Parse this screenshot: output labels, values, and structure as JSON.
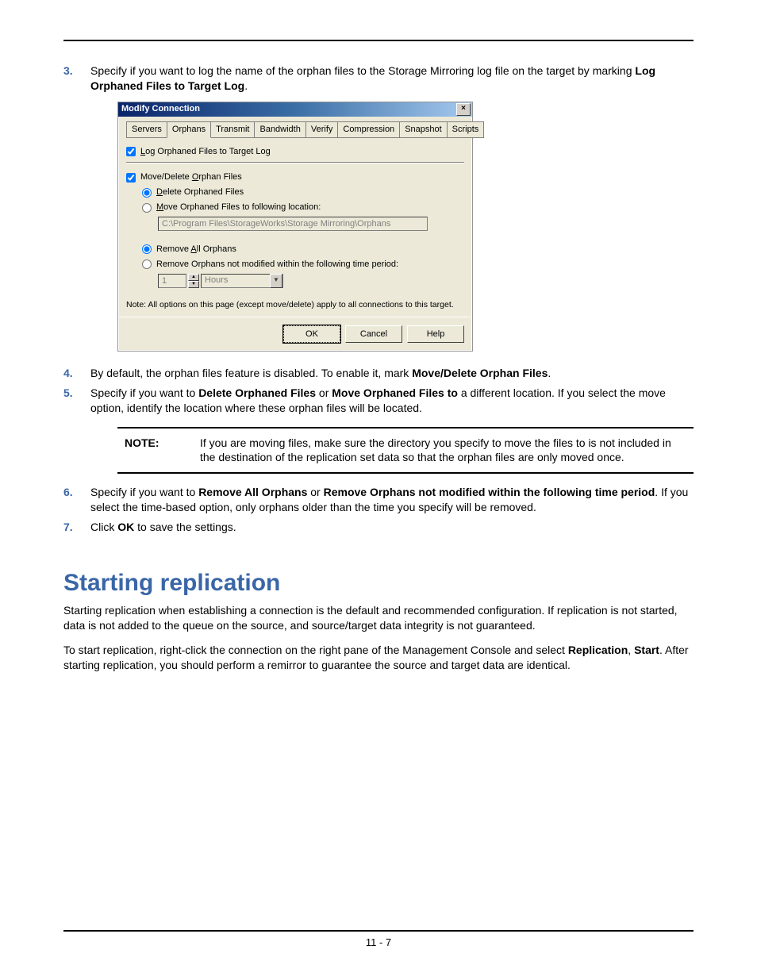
{
  "step3": {
    "num": "3.",
    "pre": "Specify if you want to log the name of the orphan files to the Storage Mirroring log file on the target by marking ",
    "bold": "Log Orphaned Files to Target Log",
    "post": "."
  },
  "dialog": {
    "title": "Modify Connection",
    "tabs": [
      "Servers",
      "Orphans",
      "Transmit",
      "Bandwidth",
      "Verify",
      "Compression",
      "Snapshot",
      "Scripts"
    ],
    "logLabel": "og Orphaned Files to Target Log",
    "logMn": "L",
    "moveDeleteLabel": "rphan Files",
    "moveDeletePre": "Move/Delete ",
    "moveDeleteMn": "O",
    "deleteLabel": "elete Orphaned Files",
    "deleteMn": "D",
    "moveToLabel": "ove Orphaned Files to following location:",
    "moveToMn": "M",
    "path": "C:\\Program Files\\StorageWorks\\Storage Mirroring\\Orphans",
    "removeAllPre": "Remove ",
    "removeAllMn": "A",
    "removeAllPost": "ll Orphans",
    "removeTime": "Remove Orphans not modified within the following time period:",
    "numVal": "1",
    "unit": "Hours",
    "note": "Note: All options on this page (except move/delete) apply to all connections to this target.",
    "ok": "OK",
    "cancel": "Cancel",
    "help": "Help"
  },
  "step4": {
    "num": "4.",
    "pre": "By default, the orphan files feature is disabled. To enable it, mark ",
    "bold": "Move/Delete Orphan Files",
    "post": "."
  },
  "step5": {
    "num": "5.",
    "pre": "Specify if you want to ",
    "b1": "Delete Orphaned Files",
    "mid1": " or ",
    "b2": "Move Orphaned Files to",
    "post": " a different location. If you select the move option, identify the location where these orphan files will be located."
  },
  "notebox": {
    "label": "NOTE:",
    "text": "If you are moving files, make sure the directory you specify to move the files to is not included in the destination of the replication set data so that the orphan files are only moved once."
  },
  "step6": {
    "num": "6.",
    "pre": "Specify if you want to ",
    "b1": "Remove All Orphans",
    "mid1": " or ",
    "b2": "Remove Orphans not modified within the following time period",
    "post": ". If you select the time-based option, only orphans older than the time you specify will be removed."
  },
  "step7": {
    "num": "7.",
    "pre": "Click ",
    "b1": "OK",
    "post": " to save the settings."
  },
  "heading": "Starting replication",
  "para1": "Starting replication when establishing a connection is the default and recommended configuration. If replication is not started, data is not added to the queue on the source, and source/target data integrity is not guaranteed.",
  "para2": {
    "pre": "To start replication, right-click the connection on the right pane of the Management Console and select ",
    "b1": "Replication",
    "mid": ", ",
    "b2": "Start",
    "post": ". After starting replication, you should perform a remirror to guarantee the source and target data are identical."
  },
  "pagenum": "11 - 7"
}
